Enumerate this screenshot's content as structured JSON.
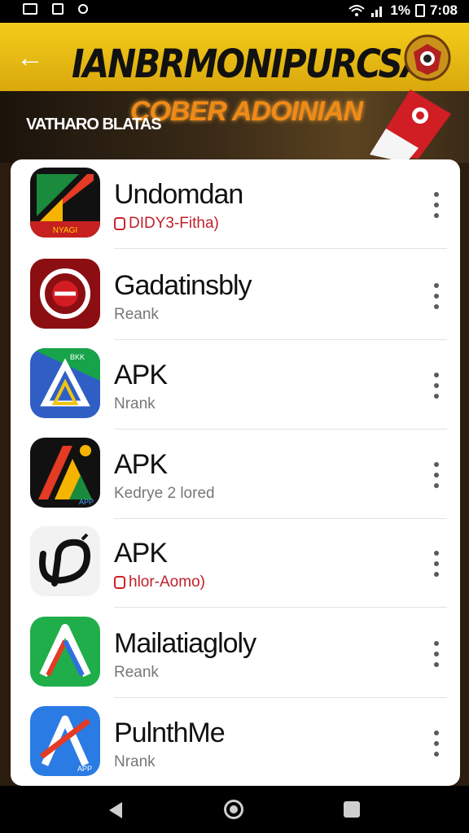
{
  "status_bar": {
    "battery_text": "1%",
    "time": "7:08"
  },
  "header": {
    "title": "IANBRMONIPURCSA",
    "back_icon": "arrow-left-icon",
    "emblem_icon": "emblem-icon"
  },
  "banner": {
    "title": "COBER ADOINIAN",
    "subtitle": "VATHARO BLATAS"
  },
  "apps": [
    {
      "name": "Undomdan",
      "sub": "DIDY3-Fitha)",
      "sub_style": "red",
      "icon": "app-icon-1"
    },
    {
      "name": "Gadatinsbly",
      "sub": "Reank",
      "sub_style": "gray",
      "icon": "app-icon-2"
    },
    {
      "name": "APK",
      "sub": "Nrank",
      "sub_style": "gray",
      "icon": "app-icon-3"
    },
    {
      "name": "APK",
      "sub": "Kedrye 2 lored",
      "sub_style": "gray",
      "icon": "app-icon-4"
    },
    {
      "name": "APK",
      "sub": "hlor-Aomo)",
      "sub_style": "red",
      "icon": "app-icon-5"
    },
    {
      "name": "Mailatiagloly",
      "sub": "Reank",
      "sub_style": "gray",
      "icon": "app-icon-6"
    },
    {
      "name": "PulnthMe",
      "sub": "Nrank",
      "sub_style": "gray",
      "icon": "app-icon-7"
    }
  ],
  "icon_labels": {
    "app1": "NYAGI",
    "app3": "BKK",
    "app4": "APP",
    "app7": "APP"
  },
  "colors": {
    "header_yellow": "#f4cc1a",
    "accent_red": "#d0202a"
  }
}
